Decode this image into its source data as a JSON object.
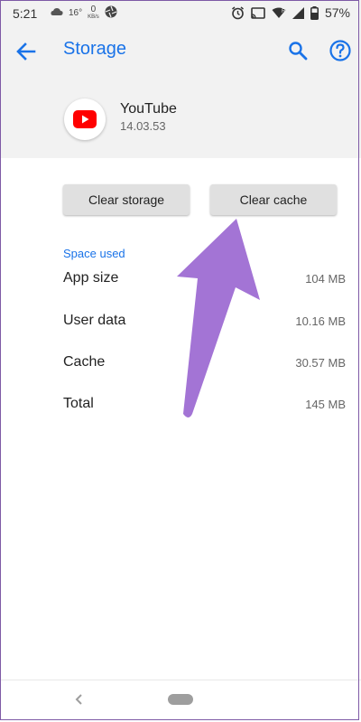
{
  "status_bar": {
    "time": "5:21",
    "temperature": "16°",
    "data_speed_value": "0",
    "data_speed_unit": "KB/s",
    "battery": "57%"
  },
  "header": {
    "title": "Storage"
  },
  "app": {
    "name": "YouTube",
    "version": "14.03.53"
  },
  "buttons": {
    "clear_storage": "Clear storage",
    "clear_cache": "Clear cache"
  },
  "space_used": {
    "header": "Space used",
    "rows": [
      {
        "label": "App size",
        "value": "104 MB"
      },
      {
        "label": "User data",
        "value": "10.16 MB"
      },
      {
        "label": "Cache",
        "value": "30.57 MB"
      },
      {
        "label": "Total",
        "value": "145 MB"
      }
    ]
  },
  "colors": {
    "accent": "#1a73e8",
    "header_bg": "#f2f2f2",
    "annotation_arrow": "#a374d5",
    "youtube_red": "#ff0000"
  },
  "icons": [
    "back-arrow-icon",
    "search-icon",
    "help-icon",
    "youtube-icon",
    "alarm-icon",
    "cast-icon",
    "wifi-icon",
    "signal-icon",
    "battery-icon",
    "cloud-icon",
    "aperture-icon"
  ]
}
